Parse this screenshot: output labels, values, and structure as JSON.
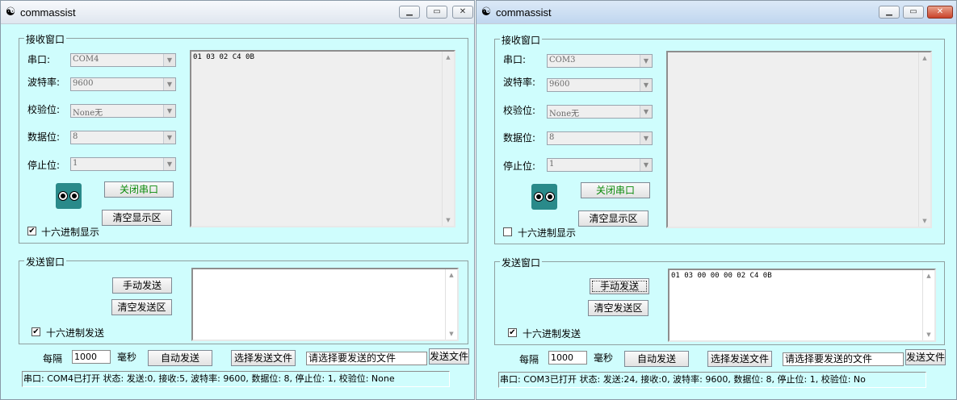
{
  "windows": [
    {
      "title": "commassist",
      "receive": {
        "group_title": "接收窗口",
        "port_label": "串口:",
        "port_value": "COM4",
        "baud_label": "波特率:",
        "baud_value": "9600",
        "parity_label": "校验位:",
        "parity_value": "None无",
        "databits_label": "数据位:",
        "databits_value": "8",
        "stopbits_label": "停止位:",
        "stopbits_value": "1",
        "open_close_button": "关闭串口",
        "clear_button": "清空显示区",
        "hex_display_label": "十六进制显示",
        "hex_display_checked": "✔",
        "content": "01 03 02 C4 0B"
      },
      "send": {
        "group_title": "发送窗口",
        "manual_send_button": "手动发送",
        "clear_send_button": "清空发送区",
        "hex_send_label": "十六进制发送",
        "hex_send_checked": "✔",
        "content": "",
        "interval_label": "每隔",
        "interval_value": "1000",
        "ms_label": "毫秒",
        "auto_send_button": "自动发送",
        "select_file_button": "选择发送文件",
        "file_path": "请选择要发送的文件",
        "send_file_button": "发送文件"
      },
      "status": "串口: COM4已打开  状态: 发送:0, 接收:5, 波特率: 9600, 数据位: 8, 停止位: 1, 校验位: None"
    },
    {
      "title": "commassist",
      "receive": {
        "group_title": "接收窗口",
        "port_label": "串口:",
        "port_value": "COM3",
        "baud_label": "波特率:",
        "baud_value": "9600",
        "parity_label": "校验位:",
        "parity_value": "None无",
        "databits_label": "数据位:",
        "databits_value": "8",
        "stopbits_label": "停止位:",
        "stopbits_value": "1",
        "open_close_button": "关闭串口",
        "clear_button": "清空显示区",
        "hex_display_label": "十六进制显示",
        "hex_display_checked": "",
        "content": ""
      },
      "send": {
        "group_title": "发送窗口",
        "manual_send_button": "手动发送",
        "clear_send_button": "清空发送区",
        "hex_send_label": "十六进制发送",
        "hex_send_checked": "✔",
        "content": "01 03 00 00 00 02 C4 0B",
        "interval_label": "每隔",
        "interval_value": "1000",
        "ms_label": "毫秒",
        "auto_send_button": "自动发送",
        "select_file_button": "选择发送文件",
        "file_path": "请选择要发送的文件",
        "send_file_button": "发送文件"
      },
      "status": "串口: COM3已打开  状态: 发送:24, 接收:0, 波特率: 9600, 数据位: 8, 停止位: 1, 校验位: No"
    }
  ],
  "icons": {
    "app": "app-icon",
    "minimize": "minimize-icon",
    "maximize": "maximize-icon",
    "close": "close-icon",
    "eyes": "eyes-logo",
    "dropdown": "chevron-down-icon"
  },
  "colors": {
    "window_bg": "#cffdfd",
    "open_button_text": "#0a8a0a",
    "close_button_active": "#c9432a"
  }
}
